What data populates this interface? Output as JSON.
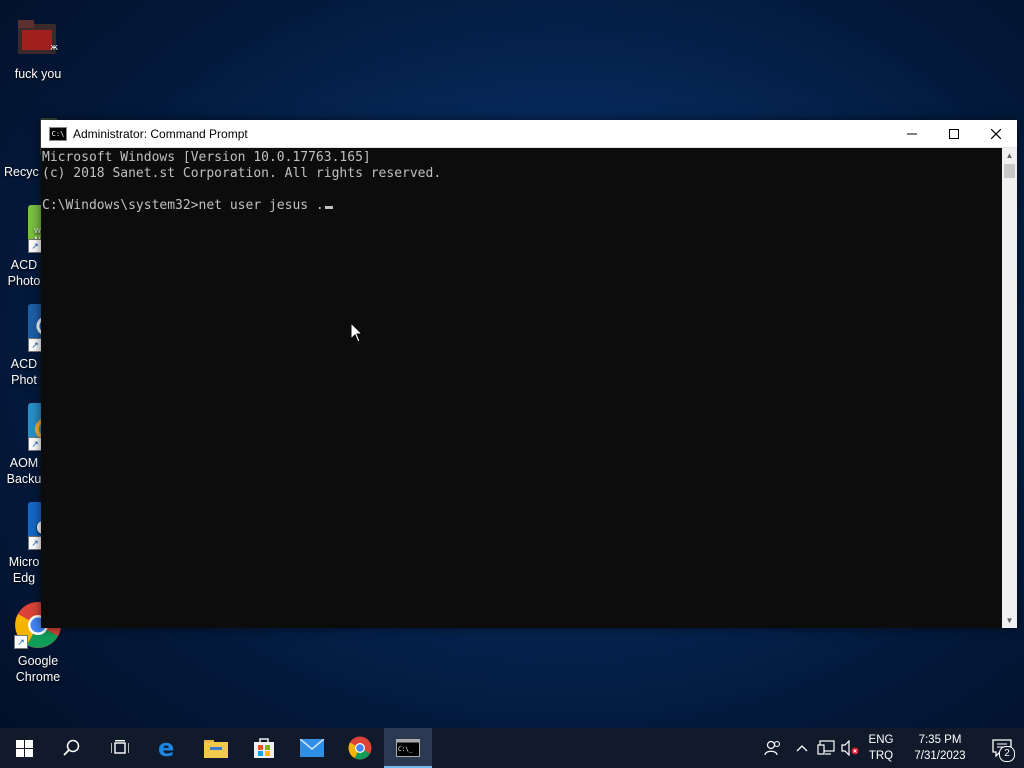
{
  "desktop": {
    "icons": [
      {
        "label": "fuck you"
      },
      {
        "label": "Recyc"
      },
      {
        "label": "ACD Photo"
      },
      {
        "label": "ACD Phot"
      },
      {
        "label": "AOM Backu"
      },
      {
        "label": "Micro Edg"
      },
      {
        "label": "Google Chrome"
      }
    ]
  },
  "window": {
    "title": "Administrator: Command Prompt",
    "console_lines": [
      "Microsoft Windows [Version 10.0.17763.165]",
      "(c) 2018 Sanet.st Corporation. All rights reserved.",
      "",
      "C:\\Windows\\system32>net user jesus ."
    ]
  },
  "taskbar": {
    "lang_top": "ENG",
    "lang_bottom": "TRQ",
    "time": "7:35 PM",
    "date": "7/31/2023",
    "notification_count": "2"
  },
  "colors": {
    "taskbar_bg": "#101a2a",
    "console_bg": "#0c0c0c",
    "console_text": "#c0c0c0",
    "accent": "#76b9ed"
  }
}
